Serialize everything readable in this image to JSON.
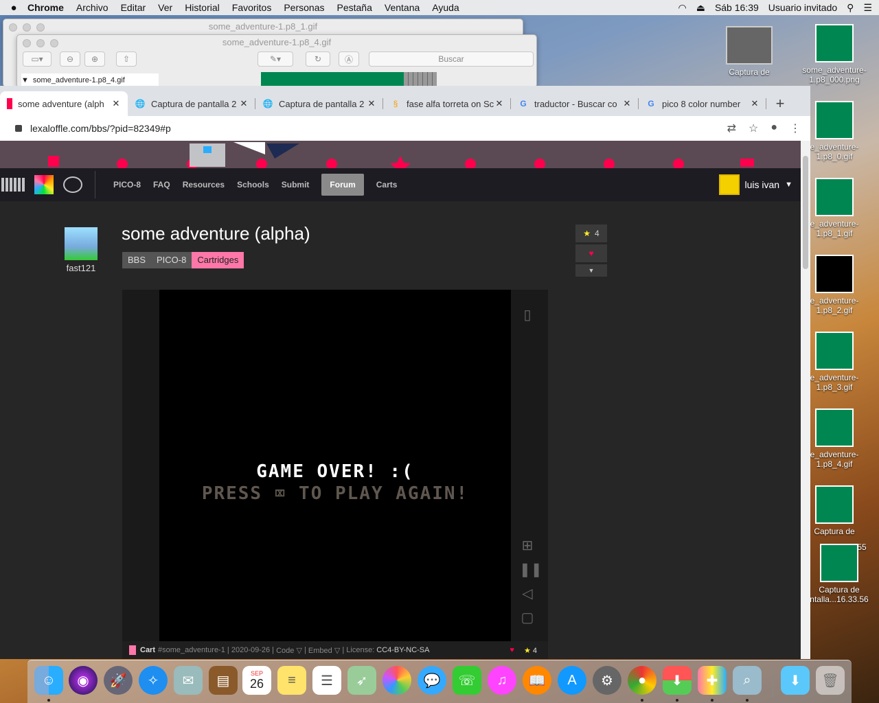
{
  "menubar": {
    "apple": "",
    "items": [
      "Chrome",
      "Archivo",
      "Editar",
      "Ver",
      "Historial",
      "Favoritos",
      "Personas",
      "Pestaña",
      "Ventana",
      "Ayuda"
    ],
    "clock": "Sáb 16:39",
    "user": "Usuario invitado"
  },
  "preview1": {
    "title": "some_adventure-1.p8_1.gif"
  },
  "preview2": {
    "title": "some_adventure-1.p8_4.gif",
    "search_placeholder": "Buscar",
    "sidebar_item": "some_adventure-1.p8_4.gif"
  },
  "tabs": [
    {
      "title": "some adventure (alph",
      "close": "✕"
    },
    {
      "title": "Captura de pantalla 2",
      "close": "✕"
    },
    {
      "title": "Captura de pantalla 2",
      "close": "✕"
    },
    {
      "title": "fase alfa torreta on Sc",
      "close": "✕"
    },
    {
      "title": "traductor - Buscar co",
      "close": "✕"
    },
    {
      "title": "pico 8 color number",
      "close": "✕"
    }
  ],
  "new_tab": "+",
  "address": {
    "url": "lexaloffle.com/bbs/?pid=82349#p"
  },
  "nav": {
    "links": [
      "PICO-8",
      "FAQ",
      "Resources",
      "Schools",
      "Submit",
      "Forum",
      "Carts"
    ],
    "active": "Forum",
    "user": "luis ivan"
  },
  "post": {
    "title": "some adventure (alpha)",
    "author": "fast121",
    "tags": [
      "BBS",
      "PICO-8",
      "Cartridges"
    ],
    "stars": "4"
  },
  "game": {
    "line1": "GAME OVER! :(",
    "line2": "PRESS ⌧ TO PLAY AGAIN!"
  },
  "cart": {
    "label": "Cart",
    "id": "#some_adventure-1",
    "date": "2020-09-26",
    "code": "Code ▽",
    "embed": "Embed ▽",
    "license_label": "License:",
    "license": "CC4-BY-NC-SA",
    "stars": "4"
  },
  "desktop": [
    {
      "label": "Captura de",
      "kind": "screenshot"
    },
    {
      "label": "some_adventure-1.p8_000.png",
      "kind": "thumb"
    },
    {
      "label": "e_adventure-1.p8_0.gif",
      "kind": "thumb"
    },
    {
      "label": "e_adventure-1.p8_1.gif",
      "kind": "green"
    },
    {
      "label": "e_adventure-1.p8_2.gif",
      "kind": "black"
    },
    {
      "label": "e_adventure-1.p8_3.gif",
      "kind": "green"
    },
    {
      "label": "e_adventure-1.p8_4.gif",
      "kind": "green"
    },
    {
      "label": "Captura de",
      "kind": "green"
    },
    {
      "label": "55",
      "kind": "text"
    },
    {
      "label": "Captura de ntalla...16.33.56",
      "kind": "green"
    }
  ],
  "dock": {
    "calendar_month": "SEP",
    "calendar_day": "26"
  },
  "colors": {
    "pico_pink": "#ff77a8",
    "pico_green": "#008751",
    "pico_gray": "#5f574f"
  }
}
